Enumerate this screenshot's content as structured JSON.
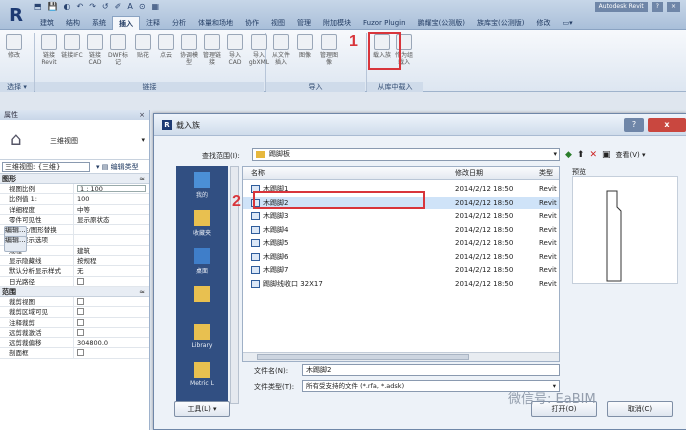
{
  "qat": {
    "items": [
      "⬒",
      "💾",
      "◐",
      "↶",
      "↷",
      "↺",
      "✐",
      "A",
      "⊙",
      "▦"
    ]
  },
  "title_right": [
    "Autodesk Revit",
    "?",
    "×"
  ],
  "ribbon_tabs": [
    "建筑",
    "结构",
    "系统",
    "插入",
    "注释",
    "分析",
    "体量和场地",
    "协作",
    "视图",
    "管理",
    "附加模块",
    "Fuzor Plugin",
    "鹏耀宝(公测版)",
    "族库宝(公测版)",
    "修改",
    "▭▾"
  ],
  "ribbon": {
    "modify": "修改",
    "btns": [
      "链接Revit",
      "链接IFC",
      "链接CAD",
      "DWF标记",
      "贴花",
      "点云",
      "协调模型",
      "管理链接",
      "导入CAD",
      "导入gbXML",
      "从文件插入",
      "图像",
      "管理图像",
      "载入族",
      "作为组载入"
    ],
    "groups": {
      "select": "选择 ▾",
      "link": "链接",
      "import": "导入",
      "library": "从库中载入"
    }
  },
  "annotations": {
    "step1": "1",
    "step2": "2"
  },
  "props": {
    "title": "属性",
    "close": "×",
    "type_name": "三维视图",
    "selector": "三维视图: {三维}",
    "edit_type": "编辑类型",
    "sections": {
      "graphics": "图形",
      "range": "范围"
    },
    "rows": [
      {
        "k": "视图比例",
        "v": "1 : 100",
        "style": "box"
      },
      {
        "k": "比例值 1:",
        "v": "100"
      },
      {
        "k": "详细程度",
        "v": "中等"
      },
      {
        "k": "零件可见性",
        "v": "显示原状态"
      },
      {
        "k": "可见性/图形替换",
        "v": "编辑...",
        "style": "btn"
      },
      {
        "k": "图形显示选项",
        "v": "编辑...",
        "style": "btn"
      },
      {
        "k": "规程",
        "v": "建筑"
      },
      {
        "k": "显示隐藏线",
        "v": "按规程"
      },
      {
        "k": "默认分析显示样式",
        "v": "无"
      },
      {
        "k": "日光路径",
        "v": "",
        "style": "cb"
      }
    ],
    "range_rows": [
      {
        "k": "裁剪视图",
        "v": "",
        "style": "cb"
      },
      {
        "k": "裁剪区域可见",
        "v": "",
        "style": "cb"
      },
      {
        "k": "注释裁剪",
        "v": "",
        "style": "cb"
      },
      {
        "k": "远剪裁激活",
        "v": "",
        "style": "cb"
      },
      {
        "k": "远剪裁偏移",
        "v": "304800.0"
      },
      {
        "k": "剖面框",
        "v": "",
        "style": "cb"
      }
    ]
  },
  "dialog": {
    "title": "载入族",
    "help": "?",
    "close": "x",
    "look_in_label": "查找范围(I):",
    "look_in_value": "踢脚板",
    "tools": {
      "back": "◆",
      "up": "⬆",
      "delete": "✕",
      "newfolder": "▣",
      "views": "查看(V) ▾"
    },
    "places": [
      "我的",
      "收藏夹",
      "桌面",
      "",
      "Library",
      "Metric L"
    ],
    "columns": {
      "name": "名称",
      "date": "修改日期",
      "type": "类型"
    },
    "files": [
      {
        "name": "木踢脚1",
        "date": "2014/2/12 18:50",
        "type": "Revit"
      },
      {
        "name": "木踢脚2",
        "date": "2014/2/12 18:50",
        "type": "Revit"
      },
      {
        "name": "木踢脚3",
        "date": "2014/2/12 18:50",
        "type": "Revit"
      },
      {
        "name": "木踢脚4",
        "date": "2014/2/12 18:50",
        "type": "Revit"
      },
      {
        "name": "木踢脚5",
        "date": "2014/2/12 18:50",
        "type": "Revit"
      },
      {
        "name": "木踢脚6",
        "date": "2014/2/12 18:50",
        "type": "Revit"
      },
      {
        "name": "木踢脚7",
        "date": "2014/2/12 18:50",
        "type": "Revit"
      },
      {
        "name": "踢脚线收口 32X17",
        "date": "2014/2/12 18:50",
        "type": "Revit"
      }
    ],
    "selected_index": 1,
    "preview_label": "预览",
    "file_name_label": "文件名(N):",
    "file_name_value": "木踢脚2",
    "file_type_label": "文件类型(T):",
    "file_type_value": "所有受支持的文件 (*.rfa, *.adsk)",
    "tools_button": "工具(L)   ▾",
    "open_button": "打开(O)",
    "cancel_button": "取消(C)"
  },
  "watermark": "微信号: EaBIM"
}
